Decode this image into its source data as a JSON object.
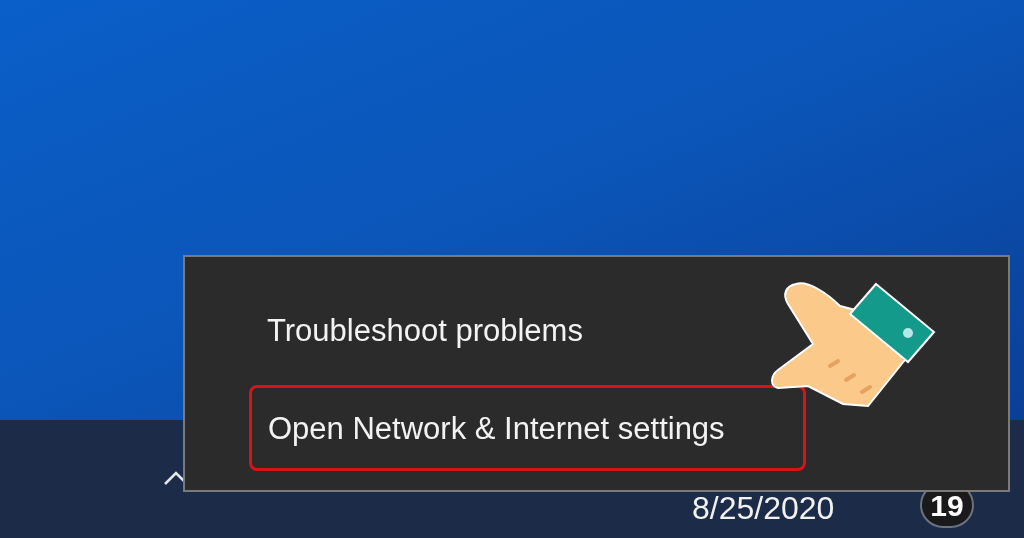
{
  "context_menu": {
    "items": [
      {
        "label": "Troubleshoot problems",
        "highlighted": false
      },
      {
        "label": "Open Network & Internet settings",
        "highlighted": true
      }
    ]
  },
  "taskbar": {
    "date": "8/25/2020",
    "notification_count": "19"
  }
}
